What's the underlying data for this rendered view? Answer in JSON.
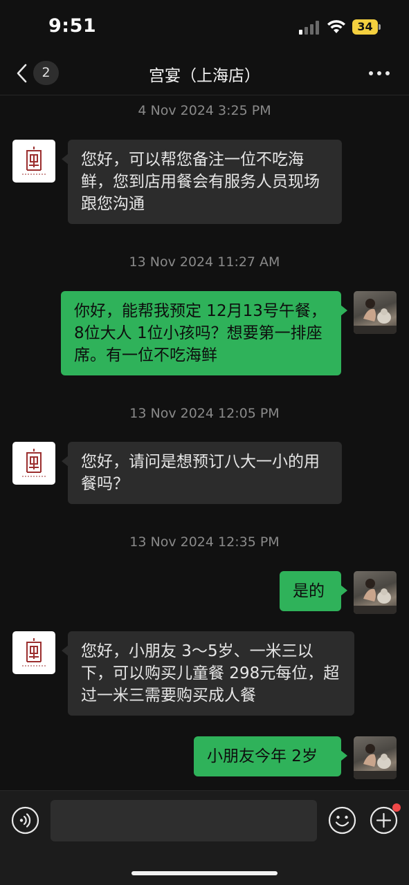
{
  "status_bar": {
    "time": "9:51",
    "battery_level": "34",
    "battery_color": "#f4d03f",
    "signal_bars_active": 1,
    "signal_bars_total": 4
  },
  "nav": {
    "back_icon": "chevron-left-icon",
    "unread_count": "2",
    "title": "宫宴（上海店）",
    "more_icon": "more-horizontal-icon"
  },
  "messages": [
    {
      "type": "timestamp",
      "text": "4 Nov 2024 3:25 PM"
    },
    {
      "type": "message",
      "sender": "shop",
      "text": "您好，可以帮您备注一位不吃海鲜，您到店用餐会有服务人员现场跟您沟通"
    },
    {
      "type": "timestamp",
      "text": "13 Nov 2024 11:27 AM"
    },
    {
      "type": "message",
      "sender": "me",
      "text": "你好，能帮我预定 12月13号午餐，8位大人 1位小孩吗？想要第一排座席。有一位不吃海鲜"
    },
    {
      "type": "timestamp",
      "text": "13 Nov 2024 12:05 PM"
    },
    {
      "type": "message",
      "sender": "shop",
      "text": "您好，请问是想预订八大一小的用餐吗？"
    },
    {
      "type": "timestamp",
      "text": "13 Nov 2024 12:35 PM"
    },
    {
      "type": "message",
      "sender": "me",
      "text": "是的"
    },
    {
      "type": "message",
      "sender": "shop",
      "text": "您好，小朋友 3～5岁、一米三以下，可以购买儿童餐 298元每位，超过一米三需要购买成人餐"
    },
    {
      "type": "message",
      "sender": "me",
      "text": "小朋友今年 2岁"
    }
  ],
  "input_bar": {
    "voice_icon": "voice-icon",
    "input_value": "",
    "emoji_icon": "emoji-icon",
    "add_icon": "plus-circle-icon",
    "has_notification": true
  },
  "colors": {
    "outgoing_bubble": "#2fb25a",
    "incoming_bubble": "#2c2c2c",
    "background": "#111111",
    "shop_logo": "#9b2e2e"
  }
}
